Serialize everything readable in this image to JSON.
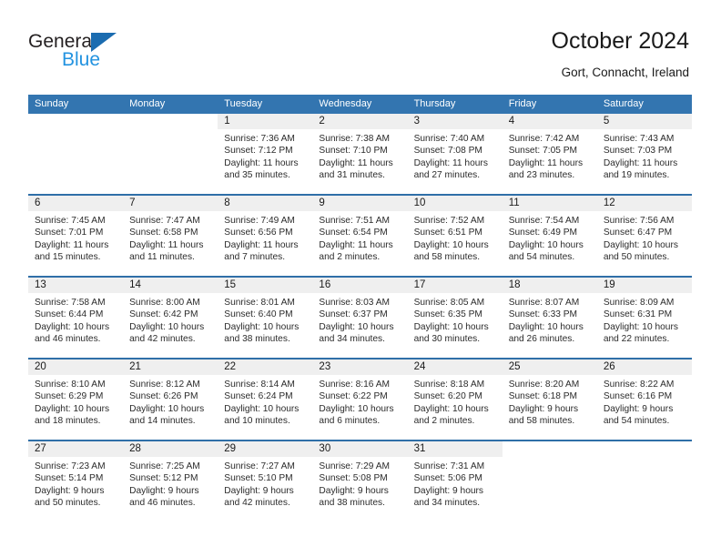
{
  "brand": {
    "name_top": "General",
    "name_bottom": "Blue",
    "triangle_color": "#1b6cb0",
    "text_color": "#231f20",
    "blue_color": "#2393e0"
  },
  "header": {
    "title": "October 2024",
    "location": "Gort, Connacht, Ireland"
  },
  "theme": {
    "header_row_bg": "#3375b0",
    "header_row_text": "#ffffff",
    "row_divider": "#2f6fa8",
    "day_number_bg": "#efefef",
    "cell_bg": "#ffffff",
    "body_text": "#2b2b2b"
  },
  "labels": {
    "sunrise_prefix": "Sunrise:",
    "sunset_prefix": "Sunset:",
    "daylight_prefix": "Daylight:"
  },
  "weekdays": [
    "Sunday",
    "Monday",
    "Tuesday",
    "Wednesday",
    "Thursday",
    "Friday",
    "Saturday"
  ],
  "weeks": [
    [
      {
        "blank": true
      },
      {
        "blank": true
      },
      {
        "day": "1",
        "sunrise": "Sunrise: 7:36 AM",
        "sunset": "Sunset: 7:12 PM",
        "daylight": "Daylight: 11 hours and 35 minutes."
      },
      {
        "day": "2",
        "sunrise": "Sunrise: 7:38 AM",
        "sunset": "Sunset: 7:10 PM",
        "daylight": "Daylight: 11 hours and 31 minutes."
      },
      {
        "day": "3",
        "sunrise": "Sunrise: 7:40 AM",
        "sunset": "Sunset: 7:08 PM",
        "daylight": "Daylight: 11 hours and 27 minutes."
      },
      {
        "day": "4",
        "sunrise": "Sunrise: 7:42 AM",
        "sunset": "Sunset: 7:05 PM",
        "daylight": "Daylight: 11 hours and 23 minutes."
      },
      {
        "day": "5",
        "sunrise": "Sunrise: 7:43 AM",
        "sunset": "Sunset: 7:03 PM",
        "daylight": "Daylight: 11 hours and 19 minutes."
      }
    ],
    [
      {
        "day": "6",
        "sunrise": "Sunrise: 7:45 AM",
        "sunset": "Sunset: 7:01 PM",
        "daylight": "Daylight: 11 hours and 15 minutes."
      },
      {
        "day": "7",
        "sunrise": "Sunrise: 7:47 AM",
        "sunset": "Sunset: 6:58 PM",
        "daylight": "Daylight: 11 hours and 11 minutes."
      },
      {
        "day": "8",
        "sunrise": "Sunrise: 7:49 AM",
        "sunset": "Sunset: 6:56 PM",
        "daylight": "Daylight: 11 hours and 7 minutes."
      },
      {
        "day": "9",
        "sunrise": "Sunrise: 7:51 AM",
        "sunset": "Sunset: 6:54 PM",
        "daylight": "Daylight: 11 hours and 2 minutes."
      },
      {
        "day": "10",
        "sunrise": "Sunrise: 7:52 AM",
        "sunset": "Sunset: 6:51 PM",
        "daylight": "Daylight: 10 hours and 58 minutes."
      },
      {
        "day": "11",
        "sunrise": "Sunrise: 7:54 AM",
        "sunset": "Sunset: 6:49 PM",
        "daylight": "Daylight: 10 hours and 54 minutes."
      },
      {
        "day": "12",
        "sunrise": "Sunrise: 7:56 AM",
        "sunset": "Sunset: 6:47 PM",
        "daylight": "Daylight: 10 hours and 50 minutes."
      }
    ],
    [
      {
        "day": "13",
        "sunrise": "Sunrise: 7:58 AM",
        "sunset": "Sunset: 6:44 PM",
        "daylight": "Daylight: 10 hours and 46 minutes."
      },
      {
        "day": "14",
        "sunrise": "Sunrise: 8:00 AM",
        "sunset": "Sunset: 6:42 PM",
        "daylight": "Daylight: 10 hours and 42 minutes."
      },
      {
        "day": "15",
        "sunrise": "Sunrise: 8:01 AM",
        "sunset": "Sunset: 6:40 PM",
        "daylight": "Daylight: 10 hours and 38 minutes."
      },
      {
        "day": "16",
        "sunrise": "Sunrise: 8:03 AM",
        "sunset": "Sunset: 6:37 PM",
        "daylight": "Daylight: 10 hours and 34 minutes."
      },
      {
        "day": "17",
        "sunrise": "Sunrise: 8:05 AM",
        "sunset": "Sunset: 6:35 PM",
        "daylight": "Daylight: 10 hours and 30 minutes."
      },
      {
        "day": "18",
        "sunrise": "Sunrise: 8:07 AM",
        "sunset": "Sunset: 6:33 PM",
        "daylight": "Daylight: 10 hours and 26 minutes."
      },
      {
        "day": "19",
        "sunrise": "Sunrise: 8:09 AM",
        "sunset": "Sunset: 6:31 PM",
        "daylight": "Daylight: 10 hours and 22 minutes."
      }
    ],
    [
      {
        "day": "20",
        "sunrise": "Sunrise: 8:10 AM",
        "sunset": "Sunset: 6:29 PM",
        "daylight": "Daylight: 10 hours and 18 minutes."
      },
      {
        "day": "21",
        "sunrise": "Sunrise: 8:12 AM",
        "sunset": "Sunset: 6:26 PM",
        "daylight": "Daylight: 10 hours and 14 minutes."
      },
      {
        "day": "22",
        "sunrise": "Sunrise: 8:14 AM",
        "sunset": "Sunset: 6:24 PM",
        "daylight": "Daylight: 10 hours and 10 minutes."
      },
      {
        "day": "23",
        "sunrise": "Sunrise: 8:16 AM",
        "sunset": "Sunset: 6:22 PM",
        "daylight": "Daylight: 10 hours and 6 minutes."
      },
      {
        "day": "24",
        "sunrise": "Sunrise: 8:18 AM",
        "sunset": "Sunset: 6:20 PM",
        "daylight": "Daylight: 10 hours and 2 minutes."
      },
      {
        "day": "25",
        "sunrise": "Sunrise: 8:20 AM",
        "sunset": "Sunset: 6:18 PM",
        "daylight": "Daylight: 9 hours and 58 minutes."
      },
      {
        "day": "26",
        "sunrise": "Sunrise: 8:22 AM",
        "sunset": "Sunset: 6:16 PM",
        "daylight": "Daylight: 9 hours and 54 minutes."
      }
    ],
    [
      {
        "day": "27",
        "sunrise": "Sunrise: 7:23 AM",
        "sunset": "Sunset: 5:14 PM",
        "daylight": "Daylight: 9 hours and 50 minutes."
      },
      {
        "day": "28",
        "sunrise": "Sunrise: 7:25 AM",
        "sunset": "Sunset: 5:12 PM",
        "daylight": "Daylight: 9 hours and 46 minutes."
      },
      {
        "day": "29",
        "sunrise": "Sunrise: 7:27 AM",
        "sunset": "Sunset: 5:10 PM",
        "daylight": "Daylight: 9 hours and 42 minutes."
      },
      {
        "day": "30",
        "sunrise": "Sunrise: 7:29 AM",
        "sunset": "Sunset: 5:08 PM",
        "daylight": "Daylight: 9 hours and 38 minutes."
      },
      {
        "day": "31",
        "sunrise": "Sunrise: 7:31 AM",
        "sunset": "Sunset: 5:06 PM",
        "daylight": "Daylight: 9 hours and 34 minutes."
      },
      {
        "blank": true
      },
      {
        "blank": true
      }
    ]
  ]
}
